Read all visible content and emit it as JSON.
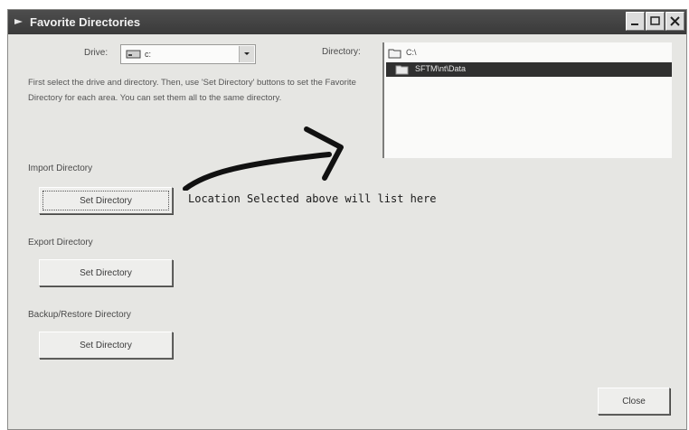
{
  "window": {
    "title": "Favorite Directories",
    "controls": [
      "minimize-icon",
      "maximize-icon",
      "close-icon"
    ]
  },
  "drive": {
    "label": "Drive:",
    "value": "c:",
    "icon": "drive-icon"
  },
  "directory": {
    "label": "Directory:",
    "items": [
      {
        "label": "C:\\",
        "icon": "open-folder-icon",
        "selected": false
      },
      {
        "label": "SFTM\\nt\\Data",
        "icon": "folder-icon",
        "selected": true
      }
    ]
  },
  "instructions": "First select the drive and directory.  Then, use 'Set Directory' buttons to set the Favorite Directory for each area.  You can set them all to the same directory.",
  "sections": [
    {
      "label": "Import Directory",
      "button": "Set Directory"
    },
    {
      "label": "Export Directory",
      "button": "Set Directory"
    },
    {
      "label": "Backup/Restore Directory",
      "button": "Set Directory"
    }
  ],
  "annotation": "Location Selected above will list here",
  "close_button": "Close"
}
